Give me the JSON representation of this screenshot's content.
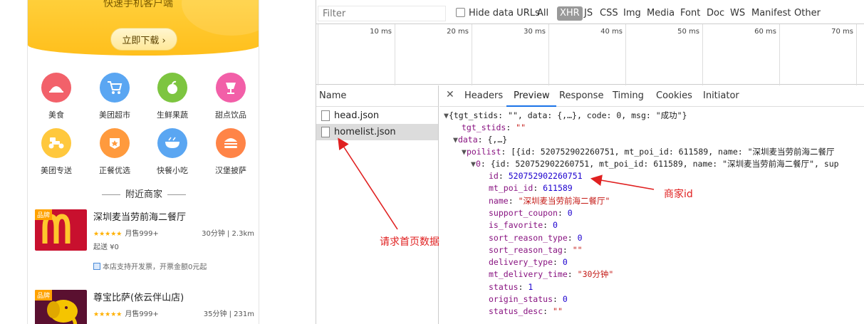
{
  "phone": {
    "banner_text": "快速手机客户端",
    "download_button": "立即下载 ›",
    "categories": [
      {
        "label": "美食",
        "icon": "dish-icon",
        "color": "#f2616a"
      },
      {
        "label": "美团超市",
        "icon": "cart-icon",
        "color": "#5aa6f2"
      },
      {
        "label": "生鲜果蔬",
        "icon": "apple-icon",
        "color": "#7dc540"
      },
      {
        "label": "甜点饮品",
        "icon": "drink-icon",
        "color": "#f25fa8"
      },
      {
        "label": "美团专送",
        "icon": "scooter-icon",
        "color": "#ffc83d"
      },
      {
        "label": "正餐优选",
        "icon": "star-icon",
        "color": "#ff9a3d"
      },
      {
        "label": "快餐小吃",
        "icon": "bowl-icon",
        "color": "#5aa6f2"
      },
      {
        "label": "汉堡披萨",
        "icon": "burger-icon",
        "color": "#ff8447"
      }
    ],
    "nearby_title": "附近商家",
    "shops": [
      {
        "tag": "品牌",
        "name": "深圳麦当劳前海二餐厅",
        "stars": "★★★★★",
        "sales": "月售999+",
        "distance": "30分钟 | 2.3km",
        "fee": "起送 ¥0",
        "invoice": "本店支持开发票，开票金额0元起"
      },
      {
        "tag": "品牌",
        "name": "尊宝比萨(依云伴山店)",
        "stars": "★★★★★",
        "sales": "月售999+",
        "distance": "35分钟 | 231m"
      }
    ]
  },
  "devtools": {
    "filter_placeholder": "Filter",
    "hide_data_urls": "Hide data URLs",
    "types": [
      "All",
      "XHR",
      "JS",
      "CSS",
      "Img",
      "Media",
      "Font",
      "Doc",
      "WS",
      "Manifest",
      "Other"
    ],
    "active_type": "XHR",
    "ticks": [
      "10 ms",
      "20 ms",
      "30 ms",
      "40 ms",
      "50 ms",
      "60 ms",
      "70 ms"
    ],
    "name_header": "Name",
    "requests": [
      "head.json",
      "homelist.json"
    ],
    "selected_request": "homelist.json",
    "tabs": [
      "Headers",
      "Preview",
      "Response",
      "Timing",
      "Cookies",
      "Initiator"
    ],
    "active_tab": "Preview",
    "preview": {
      "root": "{tgt_stids: \"\", data: {,…}, code: 0, msg: \"成功\"}",
      "tgt_stids_key": "tgt_stids",
      "tgt_stids_val": "\"\"",
      "data_key": "data",
      "data_val": "{,…}",
      "poilist_key": "poilist",
      "poilist_val": "[{id: 520752902260751, mt_poi_id: 611589, name: \"深圳麦当劳前海二餐厅",
      "item0_key": "0",
      "item0_val": "{id: 520752902260751, mt_poi_id: 611589, name: \"深圳麦当劳前海二餐厅\", sup",
      "fields": [
        {
          "k": "id",
          "v": "520752902260751",
          "t": "n"
        },
        {
          "k": "mt_poi_id",
          "v": "611589",
          "t": "n"
        },
        {
          "k": "name",
          "v": "\"深圳麦当劳前海二餐厅\"",
          "t": "s"
        },
        {
          "k": "support_coupon",
          "v": "0",
          "t": "n"
        },
        {
          "k": "is_favorite",
          "v": "0",
          "t": "n"
        },
        {
          "k": "sort_reason_type",
          "v": "0",
          "t": "n"
        },
        {
          "k": "sort_reason_tag",
          "v": "\"\"",
          "t": "s"
        },
        {
          "k": "delivery_type",
          "v": "0",
          "t": "n"
        },
        {
          "k": "mt_delivery_time",
          "v": "\"30分钟\"",
          "t": "s"
        },
        {
          "k": "status",
          "v": "1",
          "t": "n"
        },
        {
          "k": "origin_status",
          "v": "0",
          "t": "n"
        },
        {
          "k": "status_desc",
          "v": "\"\"",
          "t": "s"
        }
      ]
    }
  },
  "annotations": {
    "request_label": "请求首页数据",
    "shop_id_label": "商家id",
    "color": "#e02020"
  }
}
